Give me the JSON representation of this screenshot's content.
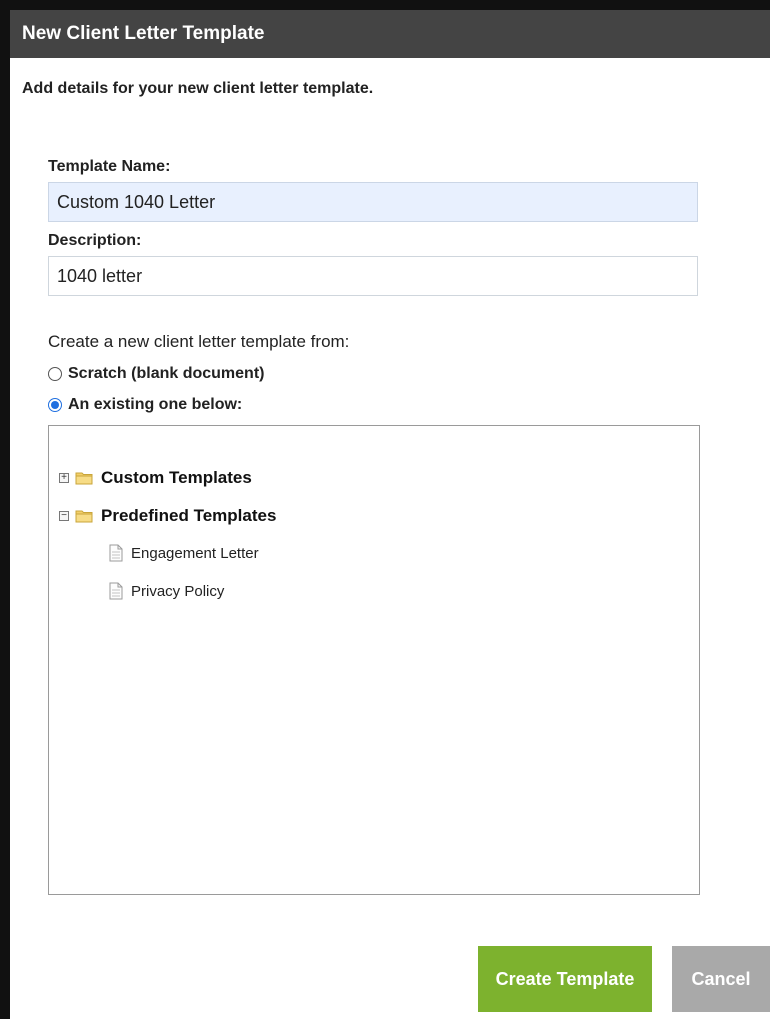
{
  "dialog": {
    "title": "New Client Letter Template",
    "intro": "Add details for your new client letter template."
  },
  "form": {
    "template_name_label": "Template Name:",
    "template_name_value": "Custom 1040 Letter",
    "description_label": "Description:",
    "description_value": "1040 letter",
    "source_prompt": "Create a new client letter template from:",
    "options": [
      {
        "label": "Scratch (blank document)",
        "checked": false
      },
      {
        "label": "An existing one below:",
        "checked": true
      }
    ]
  },
  "tree": {
    "folders": [
      {
        "label": "Custom Templates",
        "expanded": false,
        "toggle": "+"
      },
      {
        "label": "Predefined Templates",
        "expanded": true,
        "toggle": "−"
      }
    ],
    "items": [
      {
        "label": "Engagement Letter"
      },
      {
        "label": "Privacy Policy"
      }
    ]
  },
  "actions": {
    "create_label": "Create Template",
    "cancel_label": "Cancel"
  },
  "colors": {
    "titlebar": "#444444",
    "primary_button": "#7db22e",
    "secondary_button": "#a9a9a9",
    "focused_field": "#e8f0fe",
    "radio_accent": "#1f6fe0"
  }
}
